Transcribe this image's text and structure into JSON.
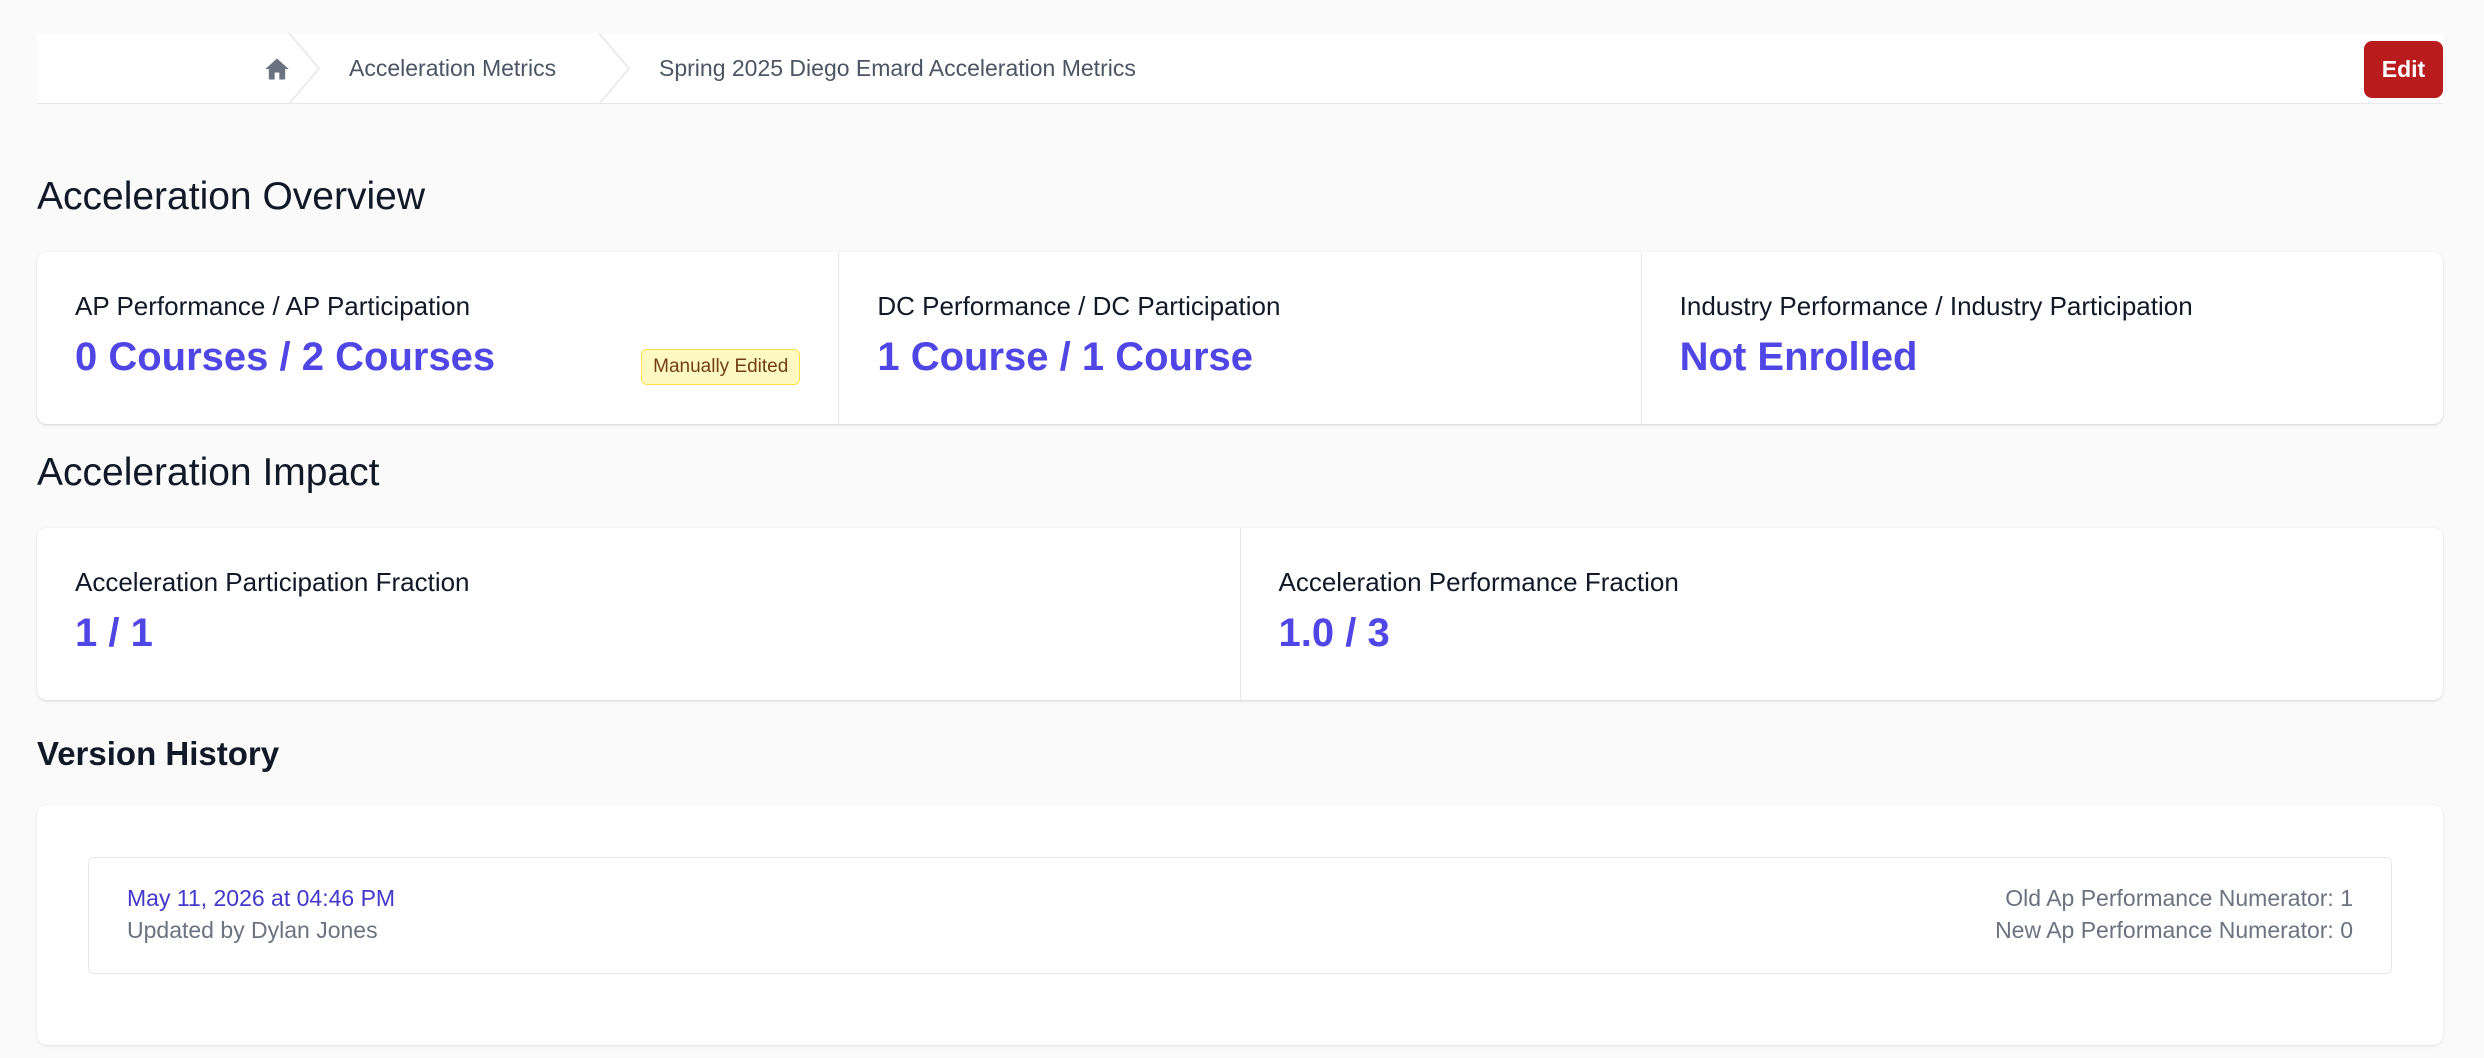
{
  "breadcrumb": {
    "items": [
      {
        "label": "Acceleration Metrics"
      },
      {
        "label": "Spring 2025 Diego Emard Acceleration Metrics"
      }
    ]
  },
  "toolbar": {
    "edit_label": "Edit"
  },
  "overview": {
    "title": "Acceleration Overview",
    "metrics": [
      {
        "label": "AP Performance / AP Participation",
        "value": "0 Courses / 2 Courses",
        "badge": "Manually Edited"
      },
      {
        "label": "DC Performance / DC Participation",
        "value": "1 Course / 1 Course"
      },
      {
        "label": "Industry Performance / Industry Participation",
        "value": "Not Enrolled"
      }
    ]
  },
  "impact": {
    "title": "Acceleration Impact",
    "metrics": [
      {
        "label": "Acceleration Participation Fraction",
        "value": "1 / 1"
      },
      {
        "label": "Acceleration Performance Fraction",
        "value": "1.0 / 3"
      }
    ]
  },
  "history": {
    "title": "Version History",
    "entries": [
      {
        "date": "May 11, 2026 at 04:46 PM",
        "updated_by": "Updated by Dylan Jones",
        "changes": [
          "Old Ap Performance Numerator: 1",
          "New Ap Performance Numerator: 0"
        ]
      }
    ]
  },
  "colors": {
    "accent": "#4f46e5",
    "danger": "#b91c1c",
    "badge_bg": "#fef9c3"
  }
}
